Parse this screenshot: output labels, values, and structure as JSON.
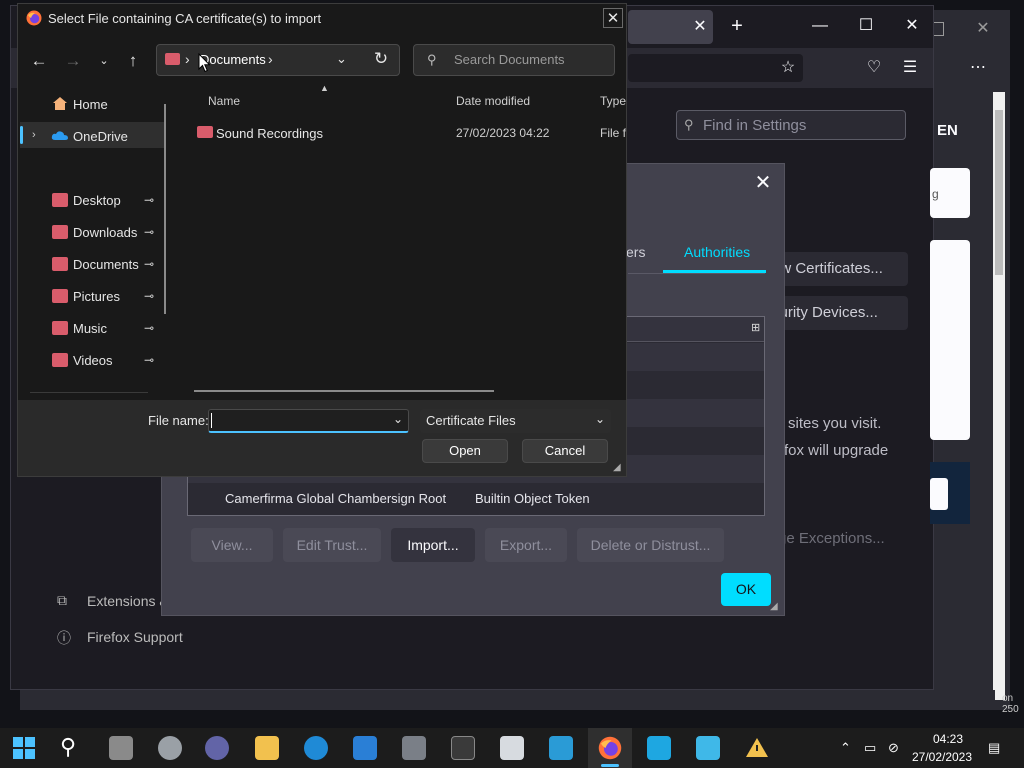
{
  "file_dialog": {
    "title": "Select File containing CA certificate(s) to import",
    "address": "Documents",
    "search_placeholder": "Search Documents",
    "sidebar": [
      {
        "label": "Home",
        "pinned": false
      },
      {
        "label": "OneDrive",
        "pinned": false
      },
      {
        "label": "Desktop",
        "pinned": true
      },
      {
        "label": "Downloads",
        "pinned": true
      },
      {
        "label": "Documents",
        "pinned": true
      },
      {
        "label": "Pictures",
        "pinned": true
      },
      {
        "label": "Music",
        "pinned": true
      },
      {
        "label": "Videos",
        "pinned": true
      }
    ],
    "columns": {
      "name": "Name",
      "date": "Date modified",
      "type": "Type"
    },
    "files": [
      {
        "name": "Sound Recordings",
        "date": "27/02/2023 04:22",
        "type": "File folder"
      }
    ],
    "filename_label": "File name:",
    "filename_value": "",
    "filetype": "Certificate Files",
    "open_label": "Open",
    "cancel_label": "Cancel"
  },
  "cert_manager": {
    "tab_others_partial": "ers",
    "tab_authorities": "Authorities",
    "last_row": {
      "name": "Camerfirma Global Chambersign Root",
      "token": "Builtin Object Token"
    },
    "buttons": [
      "View...",
      "Edit Trust...",
      "Import...",
      "Export...",
      "Delete or Distrust..."
    ],
    "ok_label": "OK"
  },
  "firefox": {
    "search_settings_placeholder": "Find in Settings",
    "language_partial": "EN",
    "view_certificates_partial": "ew Certificates...",
    "security_devices_partial": "curity Devices...",
    "text_sites_partial": "sites you visit.",
    "text_upgrade_partial": "fox will upgrade",
    "manage_exceptions_partial": "ge Exceptions...",
    "card_partial": "g",
    "sidebar_extensions_partial": "Extensions &",
    "sidebar_support": "Firefox Support"
  },
  "background_window": {
    "text_partial": "on\n250"
  },
  "taskbar": {
    "time": "04:23",
    "date": "27/02/2023"
  },
  "colors": {
    "accent_firefox": "#00ddff",
    "accent_windows": "#4cc2ff",
    "folder_icon": "#d95c6b"
  }
}
